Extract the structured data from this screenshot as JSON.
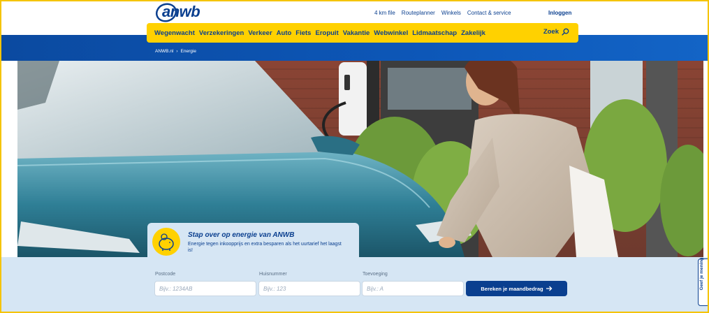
{
  "brand": {
    "logo_text": "anwb",
    "color": "#0a3f8f",
    "accent": "#ffd100"
  },
  "top_links": [
    "4 km file",
    "Routeplanner",
    "Winkels",
    "Contact & service"
  ],
  "login_label": "Inloggen",
  "nav": {
    "items": [
      "Wegenwacht",
      "Verzekeringen",
      "Verkeer",
      "Auto",
      "Fiets",
      "Eropuit",
      "Vakantie",
      "Webwinkel",
      "Lidmaatschap",
      "Zakelijk"
    ],
    "search_label": "Zoek",
    "search_icon": "search-icon"
  },
  "breadcrumb": {
    "home": "ANWB.nl",
    "separator": "›",
    "current": "Energie"
  },
  "promo": {
    "icon": "piggy-bank-icon",
    "title": "Stap over op energie van ANWB",
    "text": "Energie tegen inkoopprijs en extra besparen als het uurtarief het laagst is!"
  },
  "form": {
    "postcode": {
      "label": "Postcode",
      "placeholder": "Bijv.: 1234AB"
    },
    "huisnummer": {
      "label": "Huisnummer",
      "placeholder": "Bijv.: 123"
    },
    "toevoeging": {
      "label": "Toevoeging",
      "placeholder": "Bijv.: A"
    },
    "submit_label": "Bereken je maandbedrag",
    "submit_icon": "arrow-right-icon"
  },
  "feedback_label": "Geef je mening"
}
